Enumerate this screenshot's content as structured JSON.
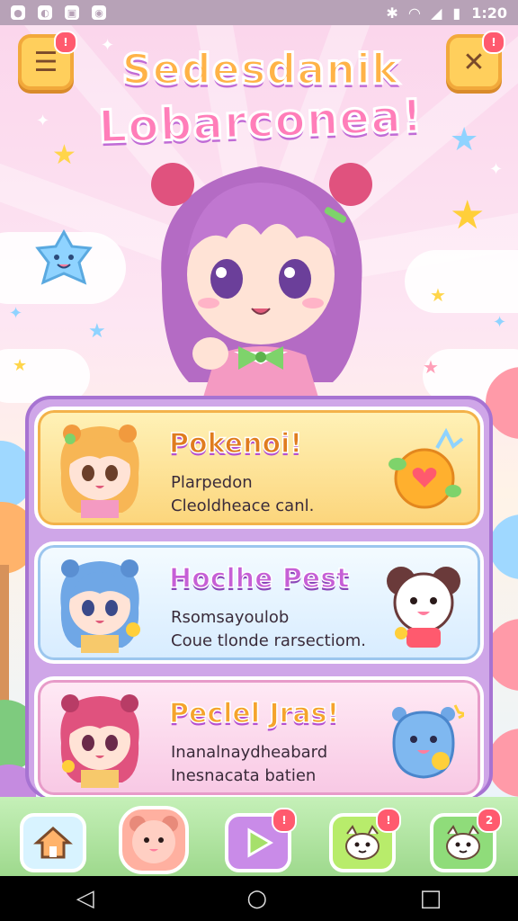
{
  "status_bar": {
    "left_icons": [
      "notification-icon",
      "notification-icon",
      "image-icon",
      "location-icon"
    ],
    "time": "1:20"
  },
  "title": {
    "line1": "Sedesdanik",
    "line2": "Lobarconea!"
  },
  "top_buttons": {
    "menu_badge": "!",
    "close_badge": "!"
  },
  "cards": [
    {
      "title": "Pokenoi!",
      "line1": "Plarpedon",
      "line2": "Cleoldheace canl."
    },
    {
      "title": "Hoclhe Pest",
      "line1": "Rsomsayoulob",
      "line2": "Coue tlonde rarsectiom."
    },
    {
      "title": "Peclel Jras!",
      "line1": "Inanalnaydheabard",
      "line2": "Inesnacata batien"
    }
  ],
  "bottom_nav": {
    "play_badge": "!",
    "friends_badge": "!",
    "pets_badge": "2"
  },
  "colors": {
    "accent_pink": "#ff7eb9",
    "accent_purple": "#a773d2",
    "accent_yellow": "#ffcf5c"
  }
}
